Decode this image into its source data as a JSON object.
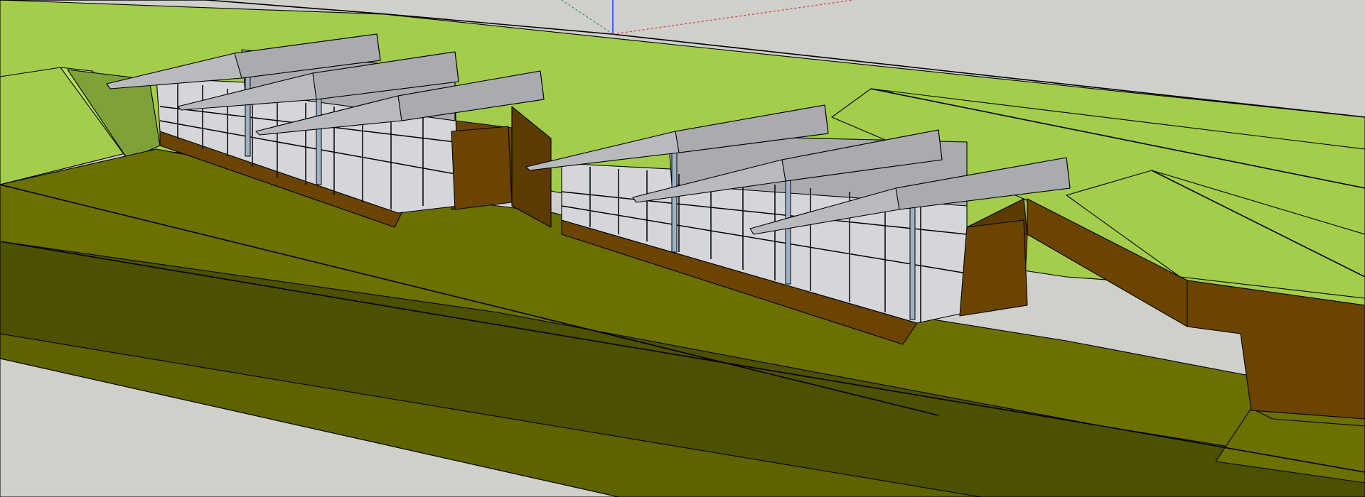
{
  "viewport": {
    "background_color": "#cfd0cc"
  },
  "axes": {
    "red_axis_color": "#d23a3a",
    "green_axis_color": "#2e9a4e",
    "blue_axis_color": "#2a3fd6"
  },
  "scene": {
    "grass_color": "#a3cd4a",
    "grass_light_color": "#b6de5a",
    "slope_color": "#6b7000",
    "slope_dark_color": "#4d5000",
    "wall_color": "#6a4400",
    "glass_color": "#d4d6d9",
    "glass_mid_color": "#a9abaf",
    "roof_color": "#b8babd"
  }
}
